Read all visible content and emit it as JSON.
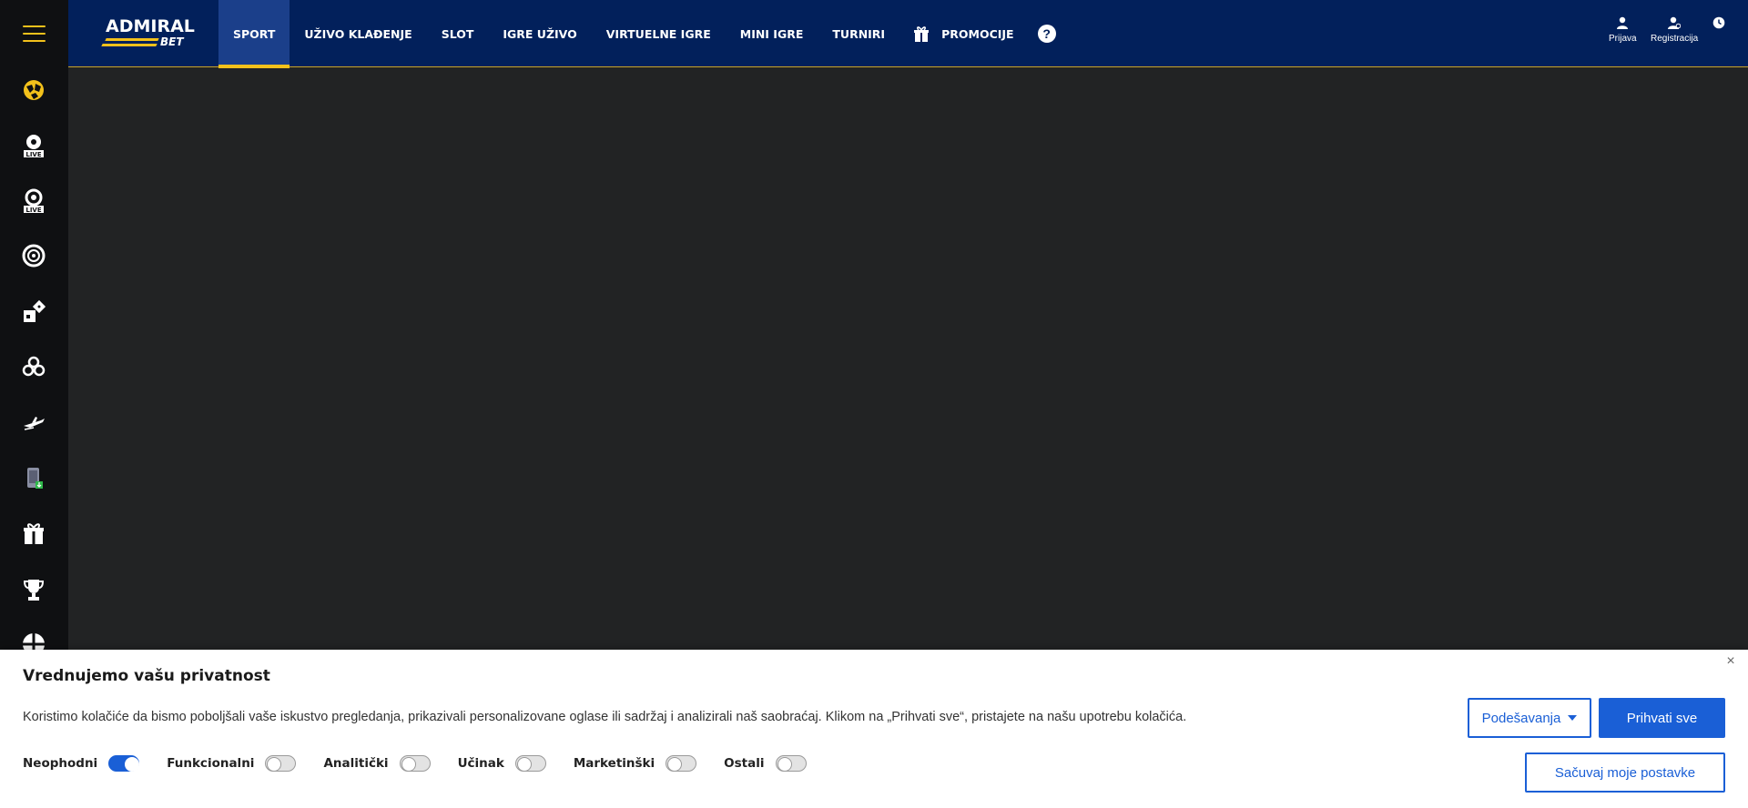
{
  "brand": {
    "name": "ADMIRAL",
    "sub": "BET"
  },
  "nav": {
    "items": [
      {
        "label": "SPORT",
        "active": true
      },
      {
        "label": "UŽIVO KLAĐENJE"
      },
      {
        "label": "SLOT"
      },
      {
        "label": "IGRE UŽIVO"
      },
      {
        "label": "VIRTUELNE IGRE"
      },
      {
        "label": "MINI IGRE"
      },
      {
        "label": "TURNIRI"
      },
      {
        "label": "PROMOCIJE",
        "icon": "gift-icon"
      }
    ],
    "help": "?"
  },
  "account": {
    "login": "Prijava",
    "register": "Registracija"
  },
  "sidebar": {
    "icons": [
      "sport-icon",
      "live-sport-icon",
      "live-casino-icon",
      "roulette-icon",
      "virtual-games-icon",
      "mini-games-icon",
      "aviator-icon",
      "mobile-app-icon",
      "gift-icon",
      "trophy-icon",
      "shield-icon"
    ]
  },
  "cookie": {
    "title": "Vrednujemo vašu privatnost",
    "text": "Koristimo kolačiće da bismo poboljšali vaše iskustvo pregledanja, prikazivali personalizovane oglase ili sadržaj i analizirali naš saobraćaj. Klikom na „Prihvati sve“, pristajete na našu upotrebu kolačića.",
    "close": "×",
    "categories": [
      {
        "label": "Neophodni",
        "on": true
      },
      {
        "label": "Funkcionalni",
        "on": false
      },
      {
        "label": "Analitički",
        "on": false
      },
      {
        "label": "Učinak",
        "on": false
      },
      {
        "label": "Marketinški",
        "on": false
      },
      {
        "label": "Ostali",
        "on": false
      }
    ],
    "settings_label": "Podešavanja",
    "accept_label": "Prihvati sve",
    "save_label": "Sačuvaj moje postavke"
  },
  "colors": {
    "header": "#02205b",
    "accent": "#f3c11b",
    "primary": "#1a5fd6",
    "background": "#222324"
  }
}
